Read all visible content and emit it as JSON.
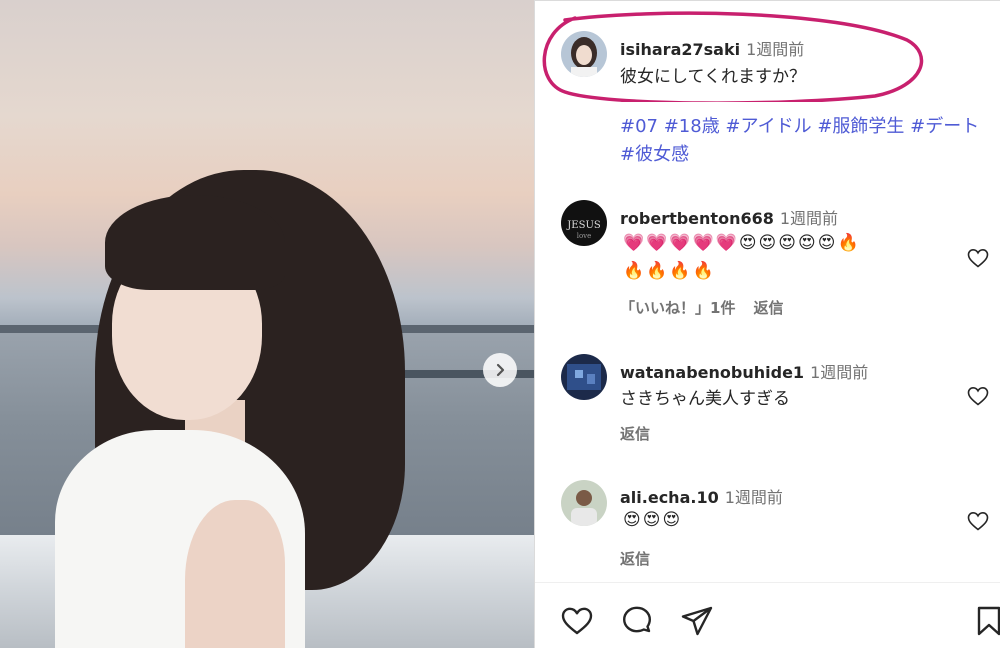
{
  "post": {
    "author": "isihara27saki",
    "time": "1週間前",
    "caption": "彼女にしてくれますか？",
    "hashtags": "#07 #18歳 #アイドル #服飾学生 #デート #彼女感"
  },
  "comments": [
    {
      "user": "robertbenton668",
      "time": "1週間前",
      "emoji_line1": "💗💗💗💗💗😍😍😍😍😍🔥",
      "emoji_line2": "🔥🔥🔥🔥",
      "likes": "「いいね！」1件",
      "reply": "返信"
    },
    {
      "user": "watanabenobuhide1",
      "time": "1週間前",
      "text": "さきちゃん美人すぎる",
      "reply": "返信"
    },
    {
      "user": "ali.echa.10",
      "time": "1週間前",
      "emoji_line1": "😍😍😍",
      "reply": "返信"
    }
  ],
  "icons": {
    "next": "chevron-right-icon",
    "like": "heart-outline-icon",
    "comment": "comment-bubble-icon",
    "share": "paper-plane-icon",
    "save": "bookmark-icon"
  },
  "colors": {
    "hashtag": "#4f5bd5",
    "highlight": "#c8206e",
    "muted": "#737373"
  }
}
